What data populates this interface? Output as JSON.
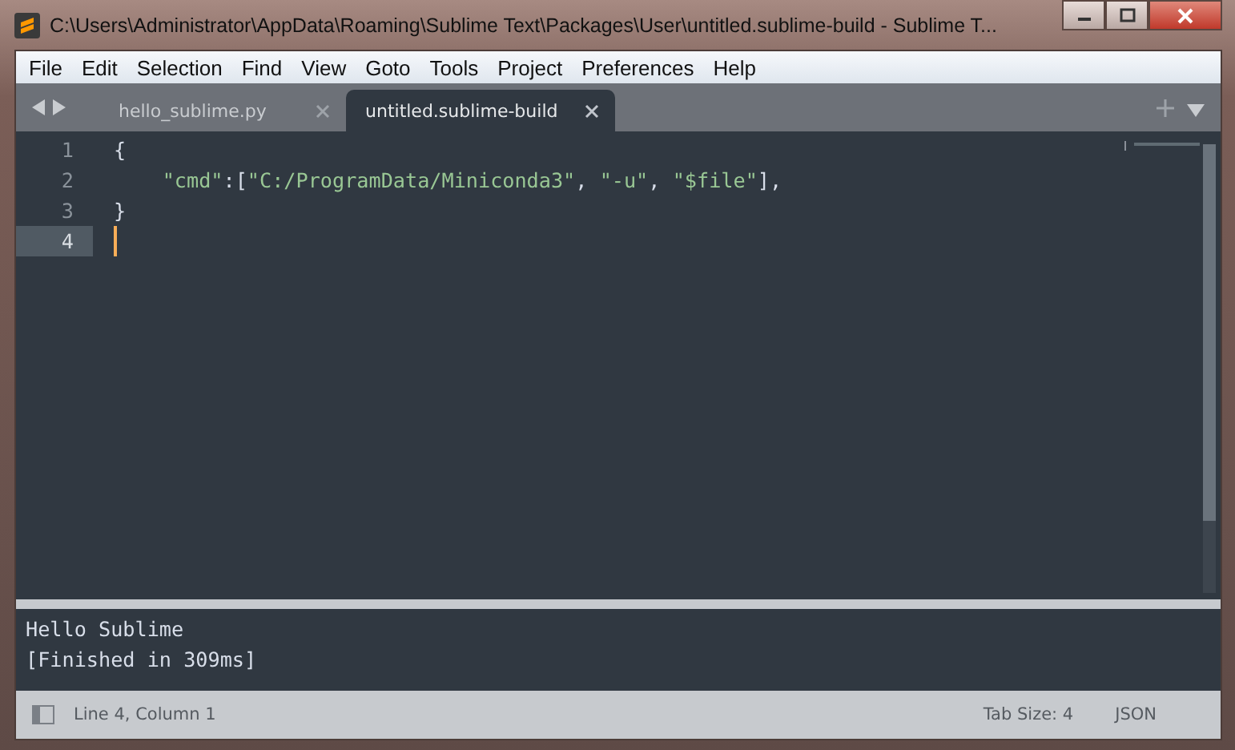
{
  "window": {
    "title": "C:\\Users\\Administrator\\AppData\\Roaming\\Sublime Text\\Packages\\User\\untitled.sublime-build - Sublime T..."
  },
  "menu": [
    "File",
    "Edit",
    "Selection",
    "Find",
    "View",
    "Goto",
    "Tools",
    "Project",
    "Preferences",
    "Help"
  ],
  "tabs": [
    {
      "label": "hello_sublime.py",
      "selected": false
    },
    {
      "label": "untitled.sublime-build",
      "selected": true
    }
  ],
  "editor": {
    "lines": [
      {
        "number": "1",
        "current": false,
        "tokens": [
          {
            "text": "{",
            "kind": "punct"
          }
        ]
      },
      {
        "number": "2",
        "current": false,
        "tokens": [
          {
            "text": "    \"cmd\"",
            "kind": "string"
          },
          {
            "text": ":[",
            "kind": "punct"
          },
          {
            "text": "\"C:/ProgramData/Miniconda3\"",
            "kind": "string"
          },
          {
            "text": ", ",
            "kind": "punct"
          },
          {
            "text": "\"-u\"",
            "kind": "string"
          },
          {
            "text": ", ",
            "kind": "punct"
          },
          {
            "text": "\"$file\"",
            "kind": "string"
          },
          {
            "text": "],",
            "kind": "punct"
          }
        ]
      },
      {
        "number": "3",
        "current": false,
        "tokens": [
          {
            "text": "}",
            "kind": "punct"
          }
        ]
      },
      {
        "number": "4",
        "current": true
      }
    ]
  },
  "output": [
    "Hello Sublime",
    "[Finished in 309ms]"
  ],
  "status_bar": {
    "position": "Line 4, Column 1",
    "tab_size": "Tab Size: 4",
    "syntax": "JSON"
  }
}
